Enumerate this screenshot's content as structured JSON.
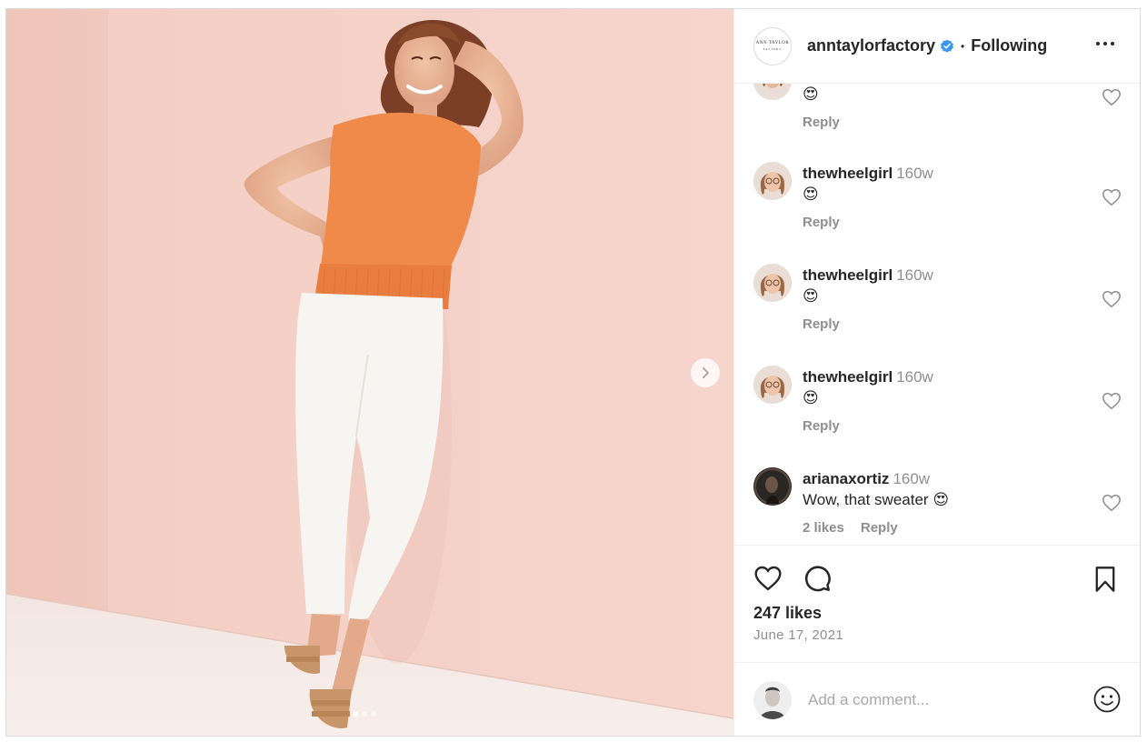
{
  "post": {
    "author": "anntaylorfactory",
    "logo_text": "ANN TAYLOR",
    "logo_subtext": "FACTORY",
    "separator": "•",
    "follow_status": "Following",
    "media": {
      "slide_count": 3,
      "active_slide": 1
    }
  },
  "comments": [
    {
      "user": "",
      "time": "",
      "text": "😍",
      "likes": "",
      "reply": "Reply"
    },
    {
      "user": "thewheelgirl",
      "time": "160w",
      "text": "😍",
      "likes": "",
      "reply": "Reply"
    },
    {
      "user": "thewheelgirl",
      "time": "160w",
      "text": "😍",
      "likes": "",
      "reply": "Reply"
    },
    {
      "user": "thewheelgirl",
      "time": "160w",
      "text": "😍",
      "likes": "",
      "reply": "Reply"
    },
    {
      "user": "arianaxortiz",
      "time": "160w",
      "text": "Wow, that sweater",
      "likes": "2 likes",
      "reply": "Reply"
    }
  ],
  "stats": {
    "likes": "247 likes",
    "date": "June 17, 2021"
  },
  "add_comment": {
    "placeholder": "Add a comment..."
  },
  "colors": {
    "accent": "#0095f6",
    "verified": "#3897f0",
    "muted": "#8e8e8e",
    "text": "#262626",
    "wall_pink": "#f3cdc3",
    "sweater_orange": "#f08a4b"
  },
  "icons": [
    "verified-badge-icon",
    "more-options-icon",
    "heart-icon",
    "comment-bubble-icon",
    "bookmark-icon",
    "smiley-icon",
    "chevron-right-icon"
  ]
}
